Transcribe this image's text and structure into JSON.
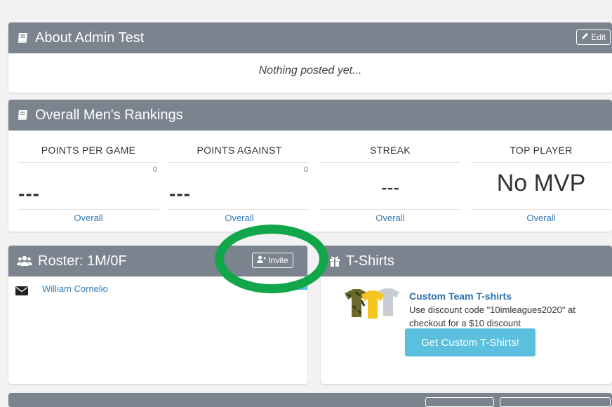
{
  "about": {
    "title": "About Admin Test",
    "edit_label": "Edit",
    "body_text": "Nothing posted yet..."
  },
  "rankings": {
    "title": "Overall Men's Rankings",
    "columns": [
      {
        "header": "POINTS PER GAME",
        "small_value": "0",
        "value": "---",
        "link": "Overall"
      },
      {
        "header": "POINTS AGAINST",
        "small_value": "0",
        "value": "---",
        "link": "Overall"
      },
      {
        "header": "STREAK",
        "value": "---",
        "link": "Overall"
      },
      {
        "header": "TOP PLAYER",
        "value": "No MVP",
        "link": "Overall"
      }
    ]
  },
  "roster": {
    "title": "Roster: 1M/0F",
    "invite_label": "Invite",
    "players": [
      {
        "name": "William Cornelio"
      }
    ]
  },
  "tshirts": {
    "title": "T-Shirts",
    "promo_title": "Custom Team T-shirts",
    "promo_text": "Use discount code \"10imleagues2020\" at checkout for a $10 discount",
    "button_label": "Get Custom T-Shirts!"
  },
  "colors": {
    "header_bg": "#7b838e",
    "link": "#337ab7",
    "accent_button": "#5bc0de",
    "highlight_ring": "#12a64a"
  },
  "icons": [
    "book-icon",
    "pencil-icon",
    "users-icon",
    "user-plus-icon",
    "envelope-icon",
    "gift-icon",
    "tshirts-image"
  ]
}
